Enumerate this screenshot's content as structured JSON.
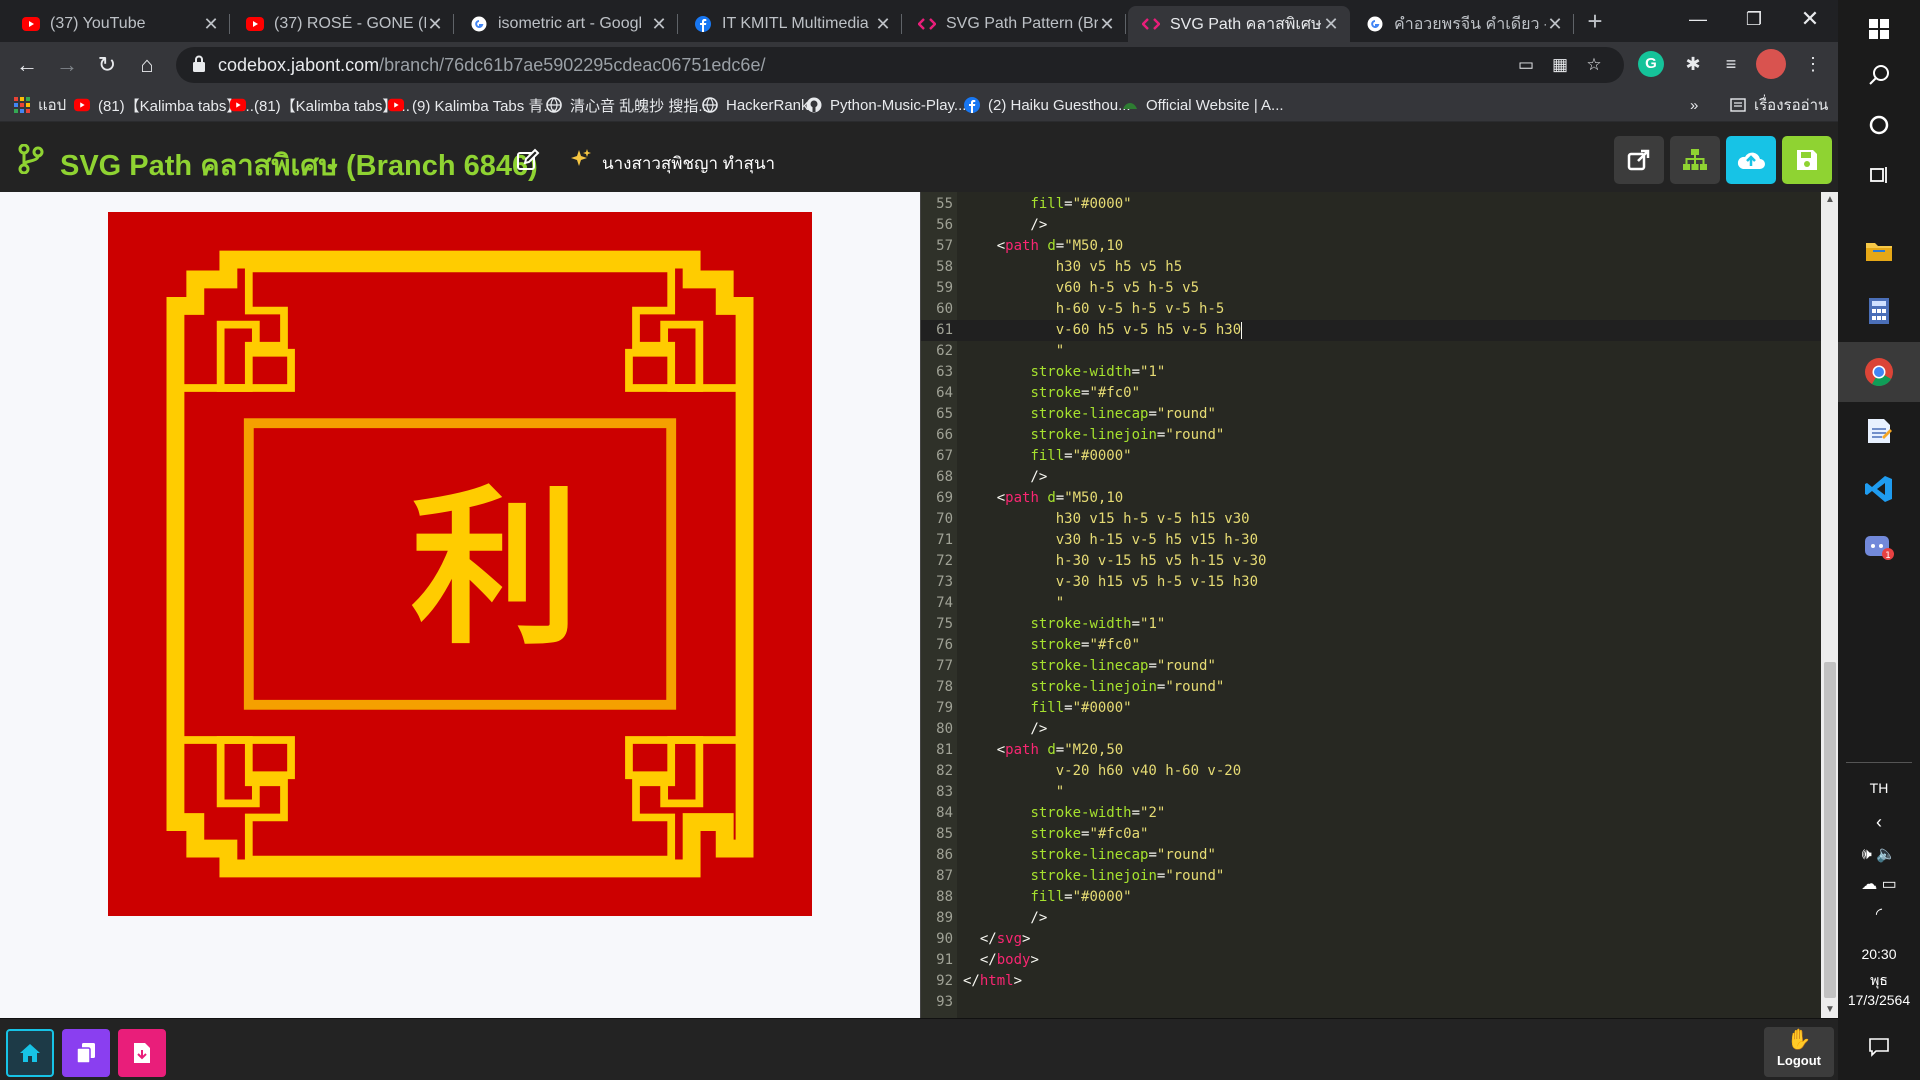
{
  "browser": {
    "tabs": [
      {
        "title": "(37) YouTube",
        "icon": "youtube-icon"
      },
      {
        "title": "(37) ROSÉ - GONE (Ly",
        "icon": "youtube-icon"
      },
      {
        "title": "isometric art - Googl",
        "icon": "google-icon"
      },
      {
        "title": "IT KMITL Multimedia",
        "icon": "facebook-icon"
      },
      {
        "title": "SVG Path Pattern (Bra",
        "icon": "codebox-icon"
      },
      {
        "title": "SVG Path คลาสพิเศษ (",
        "icon": "codebox-icon",
        "active": true
      },
      {
        "title": "คำอวยพรจีน คำเดียว - G",
        "icon": "google-icon"
      }
    ],
    "url_host": "codebox.jabont.com",
    "url_path": "/branch/76dc61b7ae5902295cdeac06751edc6e/",
    "bookmarks": [
      {
        "label": "แอป",
        "icon": "apps-grid-icon"
      },
      {
        "label": "(81)【Kalimba tabs】...",
        "icon": "youtube-icon"
      },
      {
        "label": "(81)【Kalimba tabs】...",
        "icon": "youtube-icon"
      },
      {
        "label": "(9) Kalimba Tabs 青...",
        "icon": "youtube-icon"
      },
      {
        "label": "清心音 乱魄抄 搜指...",
        "icon": "globe-icon"
      },
      {
        "label": "HackerRank",
        "icon": "globe-icon"
      },
      {
        "label": "Python-Music-Play...",
        "icon": "github-icon"
      },
      {
        "label": "(2) Haiku Guesthou...",
        "icon": "facebook-icon"
      },
      {
        "label": "Official Website | A...",
        "icon": "site-icon"
      }
    ],
    "bookmarks_more": "»",
    "reading_list": "เรื่องรออ่าน"
  },
  "app": {
    "title": "SVG Path คลาสพิเศษ (Branch 6846)",
    "author": "นางสาวสุพิชญา ทำสุนา",
    "header_buttons": [
      "open-external-button",
      "tree-button",
      "upload-button",
      "save-button"
    ],
    "logout_label": "Logout"
  },
  "artwork": {
    "background": "#cc0000",
    "frame_color": "#ffcc00",
    "inner_frame_color": "#ffcc0a",
    "glyph": "利",
    "glyph_color": "#ffcc00"
  },
  "editor": {
    "lines": [
      {
        "n": "55",
        "parts": [
          [
            "        ",
            "pun"
          ],
          [
            "fill",
            "attr"
          ],
          [
            "=",
            "pun"
          ],
          [
            "\"#0000\"",
            "str"
          ]
        ]
      },
      {
        "n": "56",
        "parts": [
          [
            "        />",
            "pun"
          ]
        ]
      },
      {
        "n": "57",
        "parts": [
          [
            "    <",
            "pun"
          ],
          [
            "path",
            "tag"
          ],
          [
            " ",
            "pun"
          ],
          [
            "d",
            "attr"
          ],
          [
            "=",
            "pun"
          ],
          [
            "\"M50,10",
            "str"
          ]
        ]
      },
      {
        "n": "58",
        "parts": [
          [
            "           h30 v5 h5 v5 h5",
            "str"
          ]
        ]
      },
      {
        "n": "59",
        "parts": [
          [
            "           v60 h-5 v5 h-5 v5",
            "str"
          ]
        ]
      },
      {
        "n": "60",
        "parts": [
          [
            "           h-60 v-5 h-5 v-5 h-5",
            "str"
          ]
        ]
      },
      {
        "n": "61",
        "parts": [
          [
            "           v-60 h5 v-5 h5 v-5 h30",
            "str"
          ]
        ],
        "cur": true
      },
      {
        "n": "62",
        "parts": [
          [
            "           \"",
            "str"
          ]
        ]
      },
      {
        "n": "63",
        "parts": [
          [
            "        ",
            "pun"
          ],
          [
            "stroke-width",
            "attr"
          ],
          [
            "=",
            "pun"
          ],
          [
            "\"1\"",
            "str"
          ]
        ]
      },
      {
        "n": "64",
        "parts": [
          [
            "        ",
            "pun"
          ],
          [
            "stroke",
            "attr"
          ],
          [
            "=",
            "pun"
          ],
          [
            "\"#fc0\"",
            "str"
          ]
        ]
      },
      {
        "n": "65",
        "parts": [
          [
            "        ",
            "pun"
          ],
          [
            "stroke-linecap",
            "attr"
          ],
          [
            "=",
            "pun"
          ],
          [
            "\"round\"",
            "str"
          ]
        ]
      },
      {
        "n": "66",
        "parts": [
          [
            "        ",
            "pun"
          ],
          [
            "stroke-linejoin",
            "attr"
          ],
          [
            "=",
            "pun"
          ],
          [
            "\"round\"",
            "str"
          ]
        ]
      },
      {
        "n": "67",
        "parts": [
          [
            "        ",
            "pun"
          ],
          [
            "fill",
            "attr"
          ],
          [
            "=",
            "pun"
          ],
          [
            "\"#0000\"",
            "str"
          ]
        ]
      },
      {
        "n": "68",
        "parts": [
          [
            "        />",
            "pun"
          ]
        ]
      },
      {
        "n": "69",
        "parts": [
          [
            "    <",
            "pun"
          ],
          [
            "path",
            "tag"
          ],
          [
            " ",
            "pun"
          ],
          [
            "d",
            "attr"
          ],
          [
            "=",
            "pun"
          ],
          [
            "\"M50,10",
            "str"
          ]
        ]
      },
      {
        "n": "70",
        "parts": [
          [
            "           h30 v15 h-5 v-5 h15 v30",
            "str"
          ]
        ]
      },
      {
        "n": "71",
        "parts": [
          [
            "           v30 h-15 v-5 h5 v15 h-30",
            "str"
          ]
        ]
      },
      {
        "n": "72",
        "parts": [
          [
            "           h-30 v-15 h5 v5 h-15 v-30",
            "str"
          ]
        ]
      },
      {
        "n": "73",
        "parts": [
          [
            "           v-30 h15 v5 h-5 v-15 h30",
            "str"
          ]
        ]
      },
      {
        "n": "74",
        "parts": [
          [
            "           \"",
            "str"
          ]
        ]
      },
      {
        "n": "75",
        "parts": [
          [
            "        ",
            "pun"
          ],
          [
            "stroke-width",
            "attr"
          ],
          [
            "=",
            "pun"
          ],
          [
            "\"1\"",
            "str"
          ]
        ]
      },
      {
        "n": "76",
        "parts": [
          [
            "        ",
            "pun"
          ],
          [
            "stroke",
            "attr"
          ],
          [
            "=",
            "pun"
          ],
          [
            "\"#fc0\"",
            "str"
          ]
        ]
      },
      {
        "n": "77",
        "parts": [
          [
            "        ",
            "pun"
          ],
          [
            "stroke-linecap",
            "attr"
          ],
          [
            "=",
            "pun"
          ],
          [
            "\"round\"",
            "str"
          ]
        ]
      },
      {
        "n": "78",
        "parts": [
          [
            "        ",
            "pun"
          ],
          [
            "stroke-linejoin",
            "attr"
          ],
          [
            "=",
            "pun"
          ],
          [
            "\"round\"",
            "str"
          ]
        ]
      },
      {
        "n": "79",
        "parts": [
          [
            "        ",
            "pun"
          ],
          [
            "fill",
            "attr"
          ],
          [
            "=",
            "pun"
          ],
          [
            "\"#0000\"",
            "str"
          ]
        ]
      },
      {
        "n": "80",
        "parts": [
          [
            "        />",
            "pun"
          ]
        ]
      },
      {
        "n": "81",
        "parts": [
          [
            "    <",
            "pun"
          ],
          [
            "path",
            "tag"
          ],
          [
            " ",
            "pun"
          ],
          [
            "d",
            "attr"
          ],
          [
            "=",
            "pun"
          ],
          [
            "\"M20,50",
            "str"
          ]
        ]
      },
      {
        "n": "82",
        "parts": [
          [
            "           v-20 h60 v40 h-60 v-20",
            "str"
          ]
        ]
      },
      {
        "n": "83",
        "parts": [
          [
            "           \"",
            "str"
          ]
        ]
      },
      {
        "n": "84",
        "parts": [
          [
            "        ",
            "pun"
          ],
          [
            "stroke-width",
            "attr"
          ],
          [
            "=",
            "pun"
          ],
          [
            "\"2\"",
            "str"
          ]
        ]
      },
      {
        "n": "85",
        "parts": [
          [
            "        ",
            "pun"
          ],
          [
            "stroke",
            "attr"
          ],
          [
            "=",
            "pun"
          ],
          [
            "\"#fc0a\"",
            "str"
          ]
        ]
      },
      {
        "n": "86",
        "parts": [
          [
            "        ",
            "pun"
          ],
          [
            "stroke-linecap",
            "attr"
          ],
          [
            "=",
            "pun"
          ],
          [
            "\"round\"",
            "str"
          ]
        ]
      },
      {
        "n": "87",
        "parts": [
          [
            "        ",
            "pun"
          ],
          [
            "stroke-linejoin",
            "attr"
          ],
          [
            "=",
            "pun"
          ],
          [
            "\"round\"",
            "str"
          ]
        ]
      },
      {
        "n": "88",
        "parts": [
          [
            "        ",
            "pun"
          ],
          [
            "fill",
            "attr"
          ],
          [
            "=",
            "pun"
          ],
          [
            "\"#0000\"",
            "str"
          ]
        ]
      },
      {
        "n": "89",
        "parts": [
          [
            "        />",
            "pun"
          ]
        ]
      },
      {
        "n": "90",
        "parts": [
          [
            "  </",
            "pun"
          ],
          [
            "svg",
            "tag"
          ],
          [
            ">",
            "pun"
          ]
        ]
      },
      {
        "n": "91",
        "parts": [
          [
            "  </",
            "pun"
          ],
          [
            "body",
            "tag"
          ],
          [
            ">",
            "pun"
          ]
        ]
      },
      {
        "n": "92",
        "parts": [
          [
            "</",
            "pun"
          ],
          [
            "html",
            "tag"
          ],
          [
            ">",
            "pun"
          ]
        ]
      },
      {
        "n": "93",
        "parts": []
      }
    ]
  },
  "taskbar": {
    "language": "TH",
    "time": "20:30",
    "day": "พุธ",
    "date": "17/3/2564",
    "notification_badge": "1",
    "colors": {
      "accent": "#8fd332",
      "tab_active": "#35363a"
    }
  }
}
